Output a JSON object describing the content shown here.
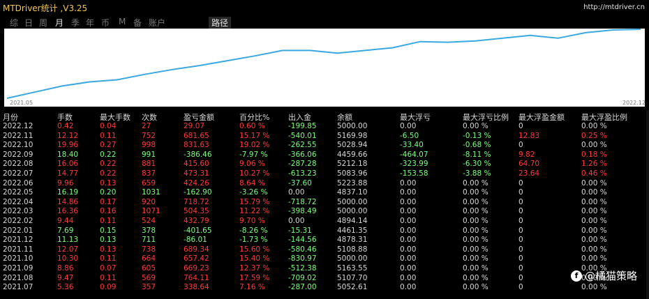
{
  "window": {
    "title": "MTDriver统计 ,V3.25",
    "url": "http://mtdriver.cn"
  },
  "tabs": [
    {
      "label": "综",
      "active": false
    },
    {
      "label": "日",
      "active": false
    },
    {
      "label": "周",
      "active": false
    },
    {
      "label": "月",
      "active": true
    },
    {
      "label": "季",
      "active": false
    },
    {
      "label": "年",
      "active": false
    },
    {
      "label": "币",
      "active": false
    },
    {
      "label": "M",
      "active": false
    },
    {
      "label": "备",
      "active": false
    },
    {
      "label": "账户",
      "active": false
    },
    {
      "label": "路径",
      "active": false
    }
  ],
  "chart": {
    "start_label": "2021.05",
    "end_label": "2022.12",
    "line_color": "#3aa8e0",
    "values": [
      0,
      0.09,
      0.18,
      0.24,
      0.27,
      0.35,
      0.42,
      0.48,
      0.55,
      0.62,
      0.7,
      0.7,
      0.66,
      0.7,
      0.74,
      0.83,
      0.82,
      0.84,
      0.88,
      0.92,
      0.88,
      0.96,
      1.0,
      1.01
    ]
  },
  "table": {
    "headers": [
      "月份",
      "手数",
      "最大手数",
      "次数",
      "盈亏金额",
      "百分比%",
      "出入金",
      "余额",
      "最大浮亏",
      "最大浮亏比例",
      "最大浮盈金额",
      "最大浮盈比例"
    ],
    "rows": [
      {
        "c": [
          "2022.12",
          "0.42",
          "0.04",
          "27",
          "29.07",
          "0.60 %",
          "-199.85",
          "5000.00",
          "0.00",
          "0.00 %",
          "0",
          "0.00 %"
        ],
        "k": [
          "w",
          "r",
          "r",
          "r",
          "r",
          "r",
          "g",
          "w",
          "w",
          "w",
          "w",
          "w"
        ]
      },
      {
        "c": [
          "2022.11",
          "12.12",
          "0.11",
          "752",
          "681.65",
          "15.17 %",
          "-540.01",
          "5169.98",
          "-6.50",
          "-0.13 %",
          "12.83",
          "0.25 %"
        ],
        "k": [
          "w",
          "r",
          "r",
          "r",
          "r",
          "r",
          "g",
          "w",
          "g",
          "g",
          "r",
          "r"
        ]
      },
      {
        "c": [
          "2022.10",
          "19.96",
          "0.27",
          "998",
          "831.63",
          "19.02 %",
          "-262.55",
          "5028.94",
          "-33.40",
          "-0.68 %",
          "0",
          "0.00 %"
        ],
        "k": [
          "w",
          "r",
          "r",
          "r",
          "r",
          "r",
          "g",
          "w",
          "g",
          "g",
          "w",
          "w"
        ]
      },
      {
        "c": [
          "2022.09",
          "18.40",
          "0.22",
          "991",
          "-386.46",
          "-7.97 %",
          "-366.06",
          "4459.66",
          "-464.07",
          "-8.11 %",
          "9.82",
          "0.18 %"
        ],
        "k": [
          "w",
          "g",
          "g",
          "g",
          "g",
          "g",
          "g",
          "w",
          "g",
          "g",
          "r",
          "r"
        ]
      },
      {
        "c": [
          "2022.08",
          "16.06",
          "0.22",
          "881",
          "415.60",
          "9.06 %",
          "-287.28",
          "5212.18",
          "-323.99",
          "-6.30 %",
          "64.70",
          "1.26 %"
        ],
        "k": [
          "w",
          "r",
          "r",
          "r",
          "r",
          "r",
          "g",
          "w",
          "g",
          "g",
          "r",
          "r"
        ]
      },
      {
        "c": [
          "2022.07",
          "14.77",
          "0.22",
          "837",
          "473.31",
          "10.27 %",
          "-613.23",
          "5083.96",
          "-153.58",
          "-3.88 %",
          "23.64",
          "0.46 %"
        ],
        "k": [
          "w",
          "r",
          "r",
          "r",
          "r",
          "r",
          "g",
          "w",
          "g",
          "g",
          "r",
          "r"
        ]
      },
      {
        "c": [
          "2022.06",
          "9.96",
          "0.13",
          "659",
          "424.26",
          "8.64 %",
          "-37.60",
          "5223.88",
          "0.00",
          "0.00 %",
          "0",
          "0.00 %"
        ],
        "k": [
          "w",
          "r",
          "r",
          "r",
          "r",
          "r",
          "g",
          "w",
          "w",
          "w",
          "w",
          "w"
        ]
      },
      {
        "c": [
          "2022.05",
          "16.19",
          "0.20",
          "1031",
          "-162.90",
          "-3.26 %",
          "0.00",
          "4837.10",
          "0.00",
          "0.00 %",
          "0",
          "0.00 %"
        ],
        "k": [
          "w",
          "g",
          "g",
          "g",
          "g",
          "g",
          "w",
          "w",
          "w",
          "w",
          "w",
          "w"
        ]
      },
      {
        "c": [
          "2022.04",
          "14.86",
          "0.17",
          "920",
          "718.72",
          "15.79 %",
          "-718.72",
          "5000.00",
          "0.00",
          "0.00 %",
          "0",
          "0.00 %"
        ],
        "k": [
          "w",
          "r",
          "r",
          "r",
          "r",
          "r",
          "g",
          "w",
          "w",
          "w",
          "w",
          "w"
        ]
      },
      {
        "c": [
          "2022.03",
          "16.36",
          "0.16",
          "1071",
          "504.35",
          "11.22 %",
          "-398.49",
          "5000.00",
          "0.00",
          "0.00 %",
          "0",
          "0.00 %"
        ],
        "k": [
          "w",
          "r",
          "r",
          "r",
          "r",
          "r",
          "g",
          "w",
          "w",
          "w",
          "w",
          "w"
        ]
      },
      {
        "c": [
          "2022.02",
          "9.44",
          "0.11",
          "524",
          "432.79",
          "9.70 %",
          "0.00",
          "4894.14",
          "0.00",
          "0.00 %",
          "0",
          "0.00 %"
        ],
        "k": [
          "w",
          "r",
          "r",
          "r",
          "r",
          "r",
          "w",
          "w",
          "w",
          "w",
          "w",
          "w"
        ]
      },
      {
        "c": [
          "2022.01",
          "7.69",
          "0.15",
          "378",
          "-401.65",
          "-8.26 %",
          "-15.31",
          "4461.35",
          "0.00",
          "0.00 %",
          "0",
          "0.00 %"
        ],
        "k": [
          "w",
          "g",
          "g",
          "g",
          "g",
          "g",
          "g",
          "w",
          "w",
          "w",
          "w",
          "w"
        ]
      },
      {
        "c": [
          "2021.12",
          "11.13",
          "0.13",
          "711",
          "-86.01",
          "-1.73 %",
          "-144.56",
          "4878.31",
          "0.00",
          "0.00 %",
          "0",
          "0.00 %"
        ],
        "k": [
          "w",
          "g",
          "g",
          "g",
          "g",
          "g",
          "g",
          "w",
          "w",
          "w",
          "w",
          "w"
        ]
      },
      {
        "c": [
          "2021.11",
          "12.07",
          "0.13",
          "738",
          "689.34",
          "15.60 %",
          "-580.46",
          "5108.88",
          "0.00",
          "0.00 %",
          "0",
          "0.00 %"
        ],
        "k": [
          "w",
          "r",
          "r",
          "r",
          "r",
          "r",
          "g",
          "w",
          "w",
          "w",
          "w",
          "w"
        ]
      },
      {
        "c": [
          "2021.10",
          "10.30",
          "0.11",
          "664",
          "657.42",
          "15.40 %",
          "-830.97",
          "5000.00",
          "0.00",
          "0.00 %",
          "0",
          "0.00 %"
        ],
        "k": [
          "w",
          "r",
          "r",
          "r",
          "r",
          "r",
          "g",
          "w",
          "w",
          "w",
          "w",
          "w"
        ]
      },
      {
        "c": [
          "2021.09",
          "8.86",
          "0.07",
          "605",
          "669.23",
          "12.37 %",
          "-512.38",
          "5163.55",
          "0.00",
          "0.00 %",
          "0",
          "0.00 %"
        ],
        "k": [
          "w",
          "r",
          "r",
          "r",
          "r",
          "r",
          "g",
          "w",
          "w",
          "w",
          "w",
          "w"
        ]
      },
      {
        "c": [
          "2021.08",
          "9.47",
          "0.11",
          "569",
          "764.11",
          "17.59 %",
          "-709.02",
          "5107.70",
          "0.00",
          "0.00 %",
          "0",
          "0.00 %"
        ],
        "k": [
          "w",
          "r",
          "r",
          "r",
          "r",
          "r",
          "g",
          "w",
          "w",
          "w",
          "w",
          "w"
        ]
      },
      {
        "c": [
          "2021.07",
          "5.36",
          "0.09",
          "357",
          "338.64",
          "7.16 %",
          "-287.00",
          "5052.61",
          "0.00",
          "0.00 %",
          "0",
          "0.00 %"
        ],
        "k": [
          "w",
          "r",
          "r",
          "r",
          "r",
          "r",
          "g",
          "w",
          "w",
          "w",
          "w",
          "w"
        ]
      }
    ]
  },
  "watermark": {
    "icon": "facebook-icon",
    "text": "@橘猫策略"
  }
}
